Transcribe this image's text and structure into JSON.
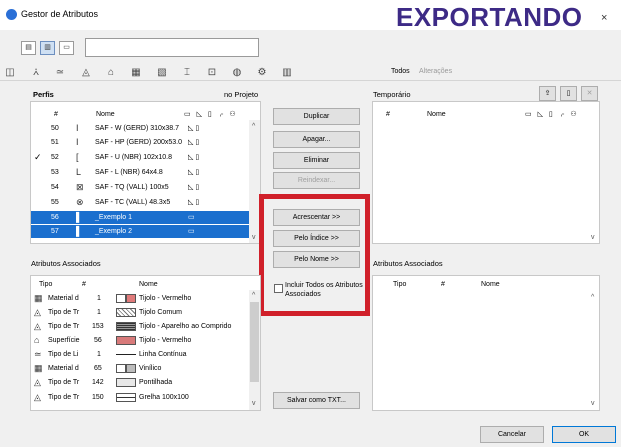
{
  "window": {
    "title": "Gestor de Atributos",
    "overlay_text": "EXPORTANDO",
    "close_glyph": "×"
  },
  "toolbar": {
    "view_buttons": [
      "list-view",
      "split-view",
      "single-view"
    ],
    "search_value": "",
    "type_icons": [
      "layer-icon",
      "pen-icon",
      "line-type-icon",
      "fill-icon",
      "building-material-icon",
      "composite-icon",
      "profile-icon",
      "surface-icon",
      "zone-icon",
      "mep-icon",
      "markup-icon",
      "table-icon"
    ],
    "tabs": [
      "Todos",
      "Alterações"
    ]
  },
  "left_panel": {
    "title": "Perfis",
    "subtitle": "no Projeto",
    "headers": {
      "num": "#",
      "name": "Nome"
    },
    "header_icons": [
      "▭",
      "◺",
      "▯",
      "⌌",
      "⚇"
    ],
    "rows": [
      {
        "check": "",
        "num": "50",
        "icon": "I",
        "name": "SAF - W (GERD) 310x38.7",
        "flags": "◺ ▯"
      },
      {
        "check": "",
        "num": "51",
        "icon": "I",
        "name": "SAF - HP (GERD) 200x53.0",
        "flags": "◺ ▯"
      },
      {
        "check": "✓",
        "num": "52",
        "icon": "[",
        "name": "SAF - U (NBR) 102x10.8",
        "flags": "◺ ▯"
      },
      {
        "check": "",
        "num": "53",
        "icon": "L",
        "name": "SAF - L (NBR) 64x4.8",
        "flags": "◺ ▯"
      },
      {
        "check": "",
        "num": "54",
        "icon": "⊠",
        "name": "SAF - TQ (VALL) 100x5",
        "flags": "◺ ▯"
      },
      {
        "check": "",
        "num": "55",
        "icon": "⊗",
        "name": "SAF - TC (VALL) 48.3x5",
        "flags": "◺ ▯"
      },
      {
        "check": "",
        "num": "56",
        "icon": "▌",
        "name": "_Exemplo 1",
        "flags": "▭"
      },
      {
        "check": "",
        "num": "57",
        "icon": "▌",
        "name": "_Exemplo 2",
        "flags": "▭"
      }
    ]
  },
  "middle_buttons": {
    "duplicar": "Duplicar",
    "apagar": "Apagar...",
    "eliminar": "Eliminar",
    "reindexar": "Reindexar...",
    "acrescentar": "Acrescentar >>",
    "pelo_indice": "Pelo Índice >>",
    "pelo_nome": "Pelo Nome >>",
    "incluir": "Incluir Todos os Atributos Associados",
    "incluir_checked": false,
    "salvar": "Salvar como TXT..."
  },
  "right_panel": {
    "title": "Temporário",
    "headers": {
      "num": "#",
      "name": "Nome"
    },
    "header_icons": [
      "▭",
      "◺",
      "▯",
      "⌌",
      "⚇"
    ]
  },
  "assoc_left": {
    "title": "Atributos Associados",
    "headers": {
      "tipo": "Tipo",
      "num": "#",
      "nome": "Nome"
    },
    "rows": [
      {
        "icon": "▦",
        "tipo": "Material d",
        "num": "1",
        "swatch": "#e07a7a",
        "nome": "Tijolo - Vermelho"
      },
      {
        "icon": "◬",
        "tipo": "Tipo de Tr",
        "num": "1",
        "swatch": "#dcdcdc",
        "nome": "Tijolo Comum"
      },
      {
        "icon": "◬",
        "tipo": "Tipo de Tr",
        "num": "153",
        "swatch": "#555555",
        "nome": "Tijolo - Aparelho ao Comprido"
      },
      {
        "icon": "⌂",
        "tipo": "Superfície",
        "num": "56",
        "swatch": "#d87a7a",
        "nome": "Tijolo - Vermelho"
      },
      {
        "icon": "≃",
        "tipo": "Tipo de Li",
        "num": "1",
        "swatch": "",
        "nome": "Linha Contínua"
      },
      {
        "icon": "▦",
        "tipo": "Material d",
        "num": "65",
        "swatch": "#bcbcbc",
        "nome": "Vinílico"
      },
      {
        "icon": "◬",
        "tipo": "Tipo de Tr",
        "num": "142",
        "swatch": "#e8e8e8",
        "nome": "Pontilhada"
      },
      {
        "icon": "◬",
        "tipo": "Tipo de Tr",
        "num": "150",
        "swatch": "#ffffff",
        "nome": "Grelha 100x100"
      }
    ]
  },
  "assoc_right": {
    "title": "Atributos Associados",
    "headers": {
      "tipo": "Tipo",
      "num": "#",
      "nome": "Nome"
    }
  },
  "footer": {
    "cancel": "Cancelar",
    "ok": "OK"
  }
}
